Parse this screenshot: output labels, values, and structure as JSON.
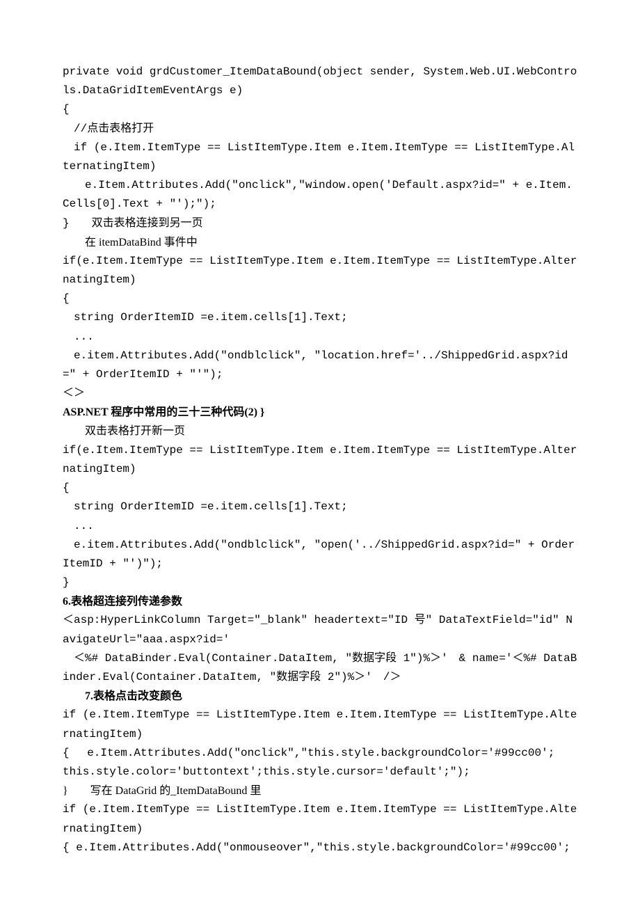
{
  "lines": [
    {
      "cls": "mono",
      "text": "private void grdCustomer_ItemDataBound(object sender, System.Web.UI.WebControls.DataGridItemEventArgs e)"
    },
    {
      "cls": "mono",
      "text": "{"
    },
    {
      "cls": "mono",
      "text": "　//点击表格打开"
    },
    {
      "cls": "mono",
      "text": "　if (e.Item.ItemType == ListItemType.Item e.Item.ItemType == ListItemType.AlternatingItem)"
    },
    {
      "cls": "mono",
      "text": "　　e.Item.Attributes.Add(\"onclick\",\"window.open('Default.aspx?id=\" + e.Item.Cells[0].Text + \"');\");"
    },
    {
      "cls": "mono",
      "text": "}　　双击表格连接到另一页"
    },
    {
      "cls": "",
      "text": "　　在 itemDataBind 事件中"
    },
    {
      "cls": "mono",
      "text": "if(e.Item.ItemType == ListItemType.Item e.Item.ItemType == ListItemType.AlternatingItem)"
    },
    {
      "cls": "mono",
      "text": "{"
    },
    {
      "cls": "mono",
      "text": "　string OrderItemID =e.item.cells[1].Text;"
    },
    {
      "cls": "mono",
      "text": "　..."
    },
    {
      "cls": "mono",
      "text": "　e.item.Attributes.Add(\"ondblclick\", \"location.href='../ShippedGrid.aspx?id=\" + OrderItemID + \"'\");"
    },
    {
      "cls": "mono",
      "text": "＜＞"
    },
    {
      "cls": "bold",
      "text": "ASP.NET 程序中常用的三十三种代码(2) }",
      "suffix": ""
    },
    {
      "cls": "mono",
      "text": "　　双击表格打开新一页"
    },
    {
      "cls": "mono",
      "text": "if(e.Item.ItemType == ListItemType.Item e.Item.ItemType == ListItemType.AlternatingItem)"
    },
    {
      "cls": "mono",
      "text": "{"
    },
    {
      "cls": "mono",
      "text": "　string OrderItemID =e.item.cells[1].Text;"
    },
    {
      "cls": "mono",
      "text": "　..."
    },
    {
      "cls": "mono",
      "text": "　e.item.Attributes.Add(\"ondblclick\", \"open('../ShippedGrid.aspx?id=\" + OrderItemID + \"')\");"
    },
    {
      "cls": "mono",
      "text": "}"
    },
    {
      "cls": "bold",
      "text": "6.表格超连接列传递参数"
    },
    {
      "cls": "mono",
      "text": "＜asp:HyperLinkColumn Target=\"_blank\" headertext=\"ID 号\" DataTextField=\"id\" NavigateUrl=\"aaa.aspx?id='"
    },
    {
      "cls": "mono",
      "text": "　＜%# DataBinder.Eval(Container.DataItem, \"数据字段 1\")%＞'　& name='＜%# DataBinder.Eval(Container.DataItem, \"数据字段 2\")%＞'　/＞"
    },
    {
      "cls": "bold",
      "text": "　　7.表格点击改变颜色"
    },
    {
      "cls": "mono",
      "text": "if (e.Item.ItemType == ListItemType.Item e.Item.ItemType == ListItemType.AlternatingItem)"
    },
    {
      "cls": "mono",
      "text": "{　 e.Item.Attributes.Add(\"onclick\",\"this.style.backgroundColor='#99cc00';"
    },
    {
      "cls": "mono",
      "text": "this.style.color='buttontext';this.style.cursor='default';\");"
    },
    {
      "cls": "",
      "text": "}　　写在 DataGrid 的_ItemDataBound 里"
    },
    {
      "cls": "mono",
      "text": "if (e.Item.ItemType == ListItemType.Item e.Item.ItemType == ListItemType.AlternatingItem)"
    },
    {
      "cls": "mono",
      "text": "{ e.Item.Attributes.Add(\"onmouseover\",\"this.style.backgroundColor='#99cc00';"
    }
  ]
}
